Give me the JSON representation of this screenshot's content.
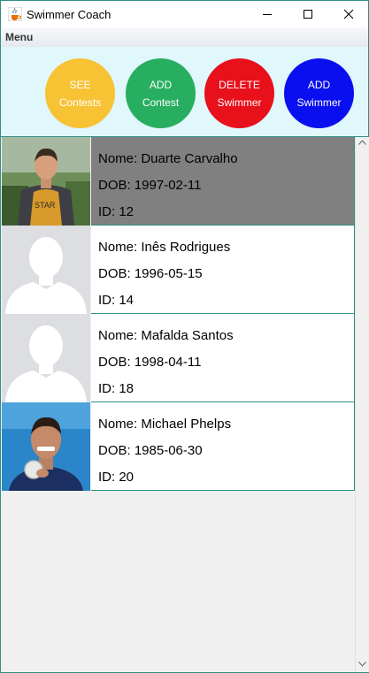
{
  "window": {
    "title": "Swimmer Coach"
  },
  "menubar": {
    "menu_label": "Menu"
  },
  "toolbar": {
    "buttons": [
      {
        "line1": "SEE",
        "line2": "Contests",
        "color": "#f7c234"
      },
      {
        "line1": "ADD",
        "line2": "Contest",
        "color": "#27ae60"
      },
      {
        "line1": "DELETE",
        "line2": "Swimmer",
        "color": "#e8101b"
      },
      {
        "line1": "ADD",
        "line2": "Swimmer",
        "color": "#0a0ff0"
      }
    ]
  },
  "swimmers": [
    {
      "name": "Nome: Duarte Carvalho",
      "dob": "DOB: 1997-02-11",
      "id": "ID: 12",
      "photo": "person-photo",
      "selected": true
    },
    {
      "name": "Nome: Inês Rodrigues",
      "dob": "DOB: 1996-05-15",
      "id": "ID: 14",
      "photo": "default-avatar",
      "selected": false
    },
    {
      "name": "Nome: Mafalda Santos",
      "dob": "DOB: 1998-04-11",
      "id": "ID: 18",
      "photo": "default-avatar",
      "selected": false
    },
    {
      "name": "Nome: Michael Phelps",
      "dob": "DOB: 1985-06-30",
      "id": "ID: 20",
      "photo": "person-photo",
      "selected": false
    }
  ],
  "colors": {
    "selected_row": "#808080",
    "border": "#2f8f83",
    "toolbar_bg": "#e0f7fb"
  }
}
